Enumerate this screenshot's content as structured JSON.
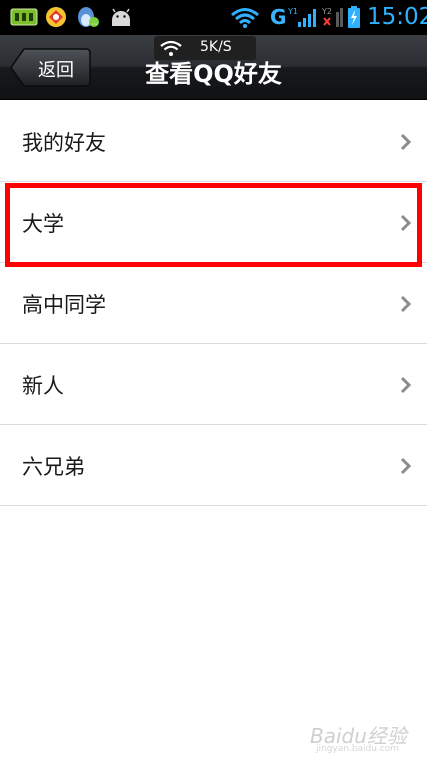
{
  "status_bar": {
    "network_type": "G",
    "time": "15:02",
    "icons": [
      "sd-card-icon",
      "game-app-icon",
      "qq-penguin-icon",
      "android-icon",
      "wifi-icon",
      "signal-1-icon",
      "signal-2-icon",
      "battery-charging-icon"
    ]
  },
  "speed_badge": {
    "text": "5K/S"
  },
  "header": {
    "back_label": "返回",
    "title": "查看QQ好友"
  },
  "groups": [
    {
      "label": "我的好友"
    },
    {
      "label": "大学"
    },
    {
      "label": "高中同学"
    },
    {
      "label": "新人"
    },
    {
      "label": "六兄弟"
    }
  ],
  "highlight": {
    "color": "#ff0000",
    "item": "大学"
  },
  "watermark": {
    "text": "Baidu经验",
    "sub": "jingyan.baidu.com"
  }
}
